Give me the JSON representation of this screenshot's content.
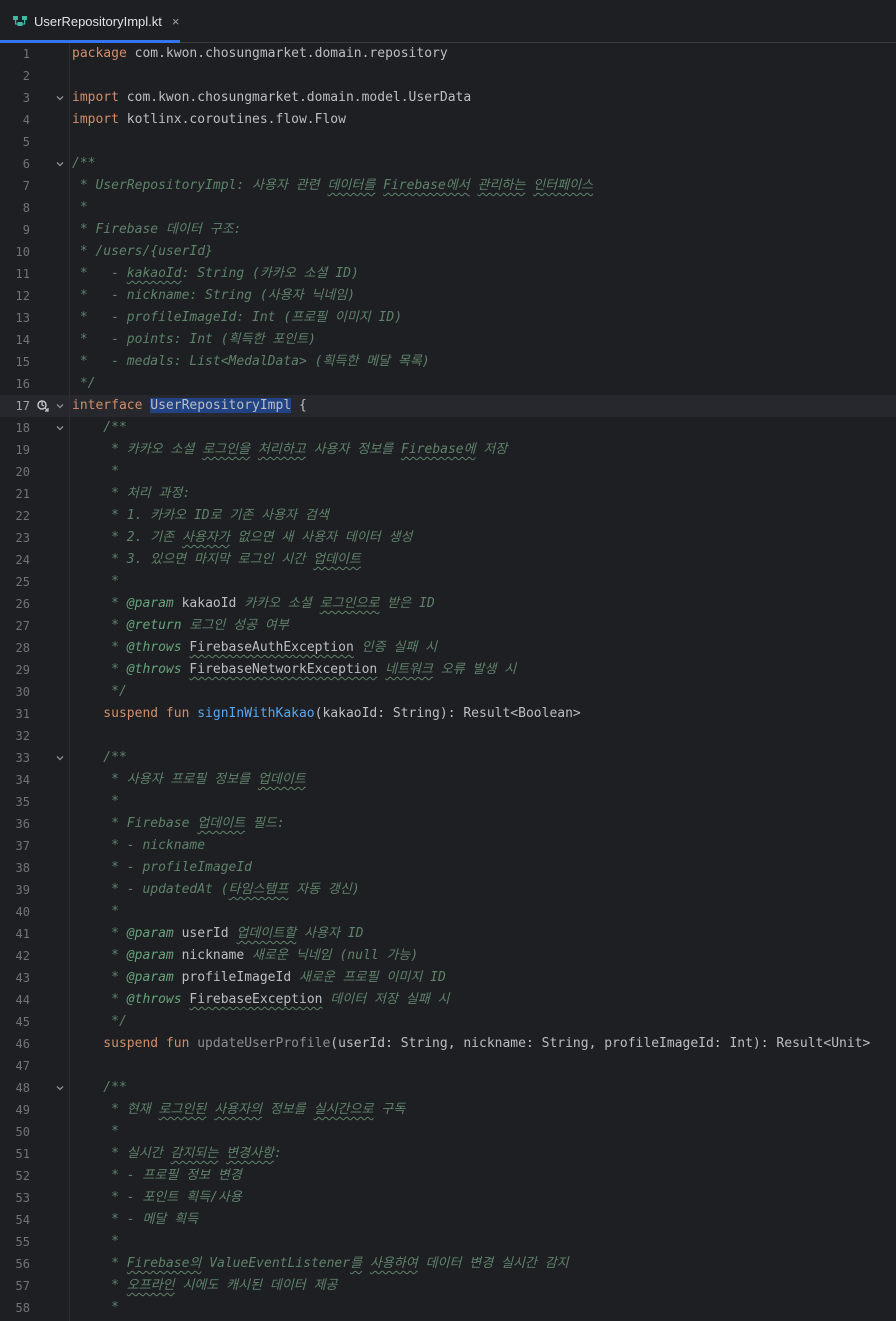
{
  "tab": {
    "label": "UserRepositoryImpl.kt",
    "close": "×"
  },
  "current_line": 17,
  "lines": [
    {
      "n": 1,
      "tokens": [
        {
          "t": "package ",
          "c": "kw"
        },
        {
          "t": "com.kwon.chosungmarket.domain.repository",
          "c": "ty"
        }
      ]
    },
    {
      "n": 2,
      "tokens": []
    },
    {
      "n": 3,
      "fold": true,
      "tokens": [
        {
          "t": "import ",
          "c": "kw"
        },
        {
          "t": "com.kwon.chosungmarket.domain.model.UserData",
          "c": "ty"
        }
      ]
    },
    {
      "n": 4,
      "tokens": [
        {
          "t": "import ",
          "c": "kw"
        },
        {
          "t": "kotlinx.coroutines.flow.Flow",
          "c": "ty"
        }
      ]
    },
    {
      "n": 5,
      "tokens": []
    },
    {
      "n": 6,
      "fold": true,
      "tokens": [
        {
          "t": "/**",
          "c": "cm"
        }
      ]
    },
    {
      "n": 7,
      "tokens": [
        {
          "t": " * UserRepositoryImpl: 사용자 관련 ",
          "c": "cm"
        },
        {
          "t": "데이터를",
          "c": "cm wavy"
        },
        {
          "t": " ",
          "c": "cm"
        },
        {
          "t": "Firebase에서",
          "c": "cm wavy"
        },
        {
          "t": " ",
          "c": "cm"
        },
        {
          "t": "관리하는",
          "c": "cm wavy"
        },
        {
          "t": " ",
          "c": "cm"
        },
        {
          "t": "인터페이스",
          "c": "cm wavy"
        }
      ]
    },
    {
      "n": 8,
      "tokens": [
        {
          "t": " *",
          "c": "cm"
        }
      ]
    },
    {
      "n": 9,
      "tokens": [
        {
          "t": " * Firebase 데이터 구조:",
          "c": "cm"
        }
      ]
    },
    {
      "n": 10,
      "tokens": [
        {
          "t": " * /users/{userId}",
          "c": "cm"
        }
      ]
    },
    {
      "n": 11,
      "tokens": [
        {
          "t": " *   - ",
          "c": "cm"
        },
        {
          "t": "kakaoId",
          "c": "cm wavy"
        },
        {
          "t": ": String (카카오 소셜 ID)",
          "c": "cm"
        }
      ]
    },
    {
      "n": 12,
      "tokens": [
        {
          "t": " *   - nickname: String (사용자 닉네임)",
          "c": "cm"
        }
      ]
    },
    {
      "n": 13,
      "tokens": [
        {
          "t": " *   - profileImageId: Int (프로필 이미지 ID)",
          "c": "cm"
        }
      ]
    },
    {
      "n": 14,
      "tokens": [
        {
          "t": " *   - points: Int (획득한 포인트)",
          "c": "cm"
        }
      ]
    },
    {
      "n": 15,
      "tokens": [
        {
          "t": " *   - medals: List<MedalData> (획득한 메달 목록)",
          "c": "cm"
        }
      ]
    },
    {
      "n": 16,
      "tokens": [
        {
          "t": " */",
          "c": "cm"
        }
      ]
    },
    {
      "n": 17,
      "fold": true,
      "marker": true,
      "tokens": [
        {
          "t": "interface ",
          "c": "kw"
        },
        {
          "t": "UserRepositoryImpl",
          "c": "sel"
        },
        {
          "t": " {",
          "c": "ty"
        }
      ]
    },
    {
      "n": 18,
      "fold": true,
      "tokens": [
        {
          "t": "    /**",
          "c": "cm"
        }
      ]
    },
    {
      "n": 19,
      "tokens": [
        {
          "t": "     * 카카오 소셜 ",
          "c": "cm"
        },
        {
          "t": "로그인을",
          "c": "cm wavy"
        },
        {
          "t": " ",
          "c": "cm"
        },
        {
          "t": "처리하고",
          "c": "cm wavy"
        },
        {
          "t": " 사용자 정보를 ",
          "c": "cm"
        },
        {
          "t": "Firebase에",
          "c": "cm wavy"
        },
        {
          "t": " 저장",
          "c": "cm"
        }
      ]
    },
    {
      "n": 20,
      "tokens": [
        {
          "t": "     *",
          "c": "cm"
        }
      ]
    },
    {
      "n": 21,
      "tokens": [
        {
          "t": "     * 처리 과정:",
          "c": "cm"
        }
      ]
    },
    {
      "n": 22,
      "tokens": [
        {
          "t": "     * 1. 카카오 ID로 기존 사용자 검색",
          "c": "cm"
        }
      ]
    },
    {
      "n": 23,
      "tokens": [
        {
          "t": "     * 2. 기존 ",
          "c": "cm"
        },
        {
          "t": "사용자가",
          "c": "cm wavy"
        },
        {
          "t": " 없으면 새 사용자 데이터 생성",
          "c": "cm"
        }
      ]
    },
    {
      "n": 24,
      "tokens": [
        {
          "t": "     * 3. 있으면 마지막 로그인 시간 ",
          "c": "cm"
        },
        {
          "t": "업데이트",
          "c": "cm wavy"
        }
      ]
    },
    {
      "n": 25,
      "tokens": [
        {
          "t": "     *",
          "c": "cm"
        }
      ]
    },
    {
      "n": 26,
      "tokens": [
        {
          "t": "     * ",
          "c": "cm"
        },
        {
          "t": "@param",
          "c": "tag"
        },
        {
          "t": " ",
          "c": "cm"
        },
        {
          "t": "kakaoId",
          "c": "ty"
        },
        {
          "t": " 카카오 소셜 ",
          "c": "cm"
        },
        {
          "t": "로그인으로",
          "c": "cm wavy"
        },
        {
          "t": " 받은 ID",
          "c": "cm"
        }
      ]
    },
    {
      "n": 27,
      "tokens": [
        {
          "t": "     * ",
          "c": "cm"
        },
        {
          "t": "@return",
          "c": "tag"
        },
        {
          "t": " 로그인 성공 여부",
          "c": "cm"
        }
      ]
    },
    {
      "n": 28,
      "tokens": [
        {
          "t": "     * ",
          "c": "cm"
        },
        {
          "t": "@throws",
          "c": "tag"
        },
        {
          "t": " ",
          "c": "cm"
        },
        {
          "t": "FirebaseAuthException",
          "c": "ty wavy"
        },
        {
          "t": " 인증 실패 시",
          "c": "cm"
        }
      ]
    },
    {
      "n": 29,
      "tokens": [
        {
          "t": "     * ",
          "c": "cm"
        },
        {
          "t": "@throws",
          "c": "tag"
        },
        {
          "t": " ",
          "c": "cm"
        },
        {
          "t": "FirebaseNetworkException",
          "c": "ty wavy"
        },
        {
          "t": " ",
          "c": "cm"
        },
        {
          "t": "네트워크",
          "c": "cm wavy"
        },
        {
          "t": " 오류 발생 시",
          "c": "cm"
        }
      ]
    },
    {
      "n": 30,
      "tokens": [
        {
          "t": "     */",
          "c": "cm"
        }
      ]
    },
    {
      "n": 31,
      "tokens": [
        {
          "t": "    suspend fun ",
          "c": "kw"
        },
        {
          "t": "signInWithKakao",
          "c": "fn"
        },
        {
          "t": "(kakaoId: String): Result<Boolean>",
          "c": "ty"
        }
      ]
    },
    {
      "n": 32,
      "tokens": []
    },
    {
      "n": 33,
      "fold": true,
      "tokens": [
        {
          "t": "    /**",
          "c": "cm"
        }
      ]
    },
    {
      "n": 34,
      "tokens": [
        {
          "t": "     * 사용자 프로필 정보를 ",
          "c": "cm"
        },
        {
          "t": "업데이트",
          "c": "cm wavy"
        }
      ]
    },
    {
      "n": 35,
      "tokens": [
        {
          "t": "     *",
          "c": "cm"
        }
      ]
    },
    {
      "n": 36,
      "tokens": [
        {
          "t": "     * Firebase ",
          "c": "cm"
        },
        {
          "t": "업데이트",
          "c": "cm wavy"
        },
        {
          "t": " 필드:",
          "c": "cm"
        }
      ]
    },
    {
      "n": 37,
      "tokens": [
        {
          "t": "     * - nickname",
          "c": "cm"
        }
      ]
    },
    {
      "n": 38,
      "tokens": [
        {
          "t": "     * - profileImageId",
          "c": "cm"
        }
      ]
    },
    {
      "n": 39,
      "tokens": [
        {
          "t": "     * - updatedAt (",
          "c": "cm"
        },
        {
          "t": "타임스탬프",
          "c": "cm wavy"
        },
        {
          "t": " 자동 갱신)",
          "c": "cm"
        }
      ]
    },
    {
      "n": 40,
      "tokens": [
        {
          "t": "     *",
          "c": "cm"
        }
      ]
    },
    {
      "n": 41,
      "tokens": [
        {
          "t": "     * ",
          "c": "cm"
        },
        {
          "t": "@param",
          "c": "tag"
        },
        {
          "t": " ",
          "c": "cm"
        },
        {
          "t": "userId",
          "c": "ty"
        },
        {
          "t": " ",
          "c": "cm"
        },
        {
          "t": "업데이트할",
          "c": "cm wavy"
        },
        {
          "t": " 사용자 ID",
          "c": "cm"
        }
      ]
    },
    {
      "n": 42,
      "tokens": [
        {
          "t": "     * ",
          "c": "cm"
        },
        {
          "t": "@param",
          "c": "tag"
        },
        {
          "t": " ",
          "c": "cm"
        },
        {
          "t": "nickname",
          "c": "ty"
        },
        {
          "t": " 새로운 닉네임 (null 가능)",
          "c": "cm"
        }
      ]
    },
    {
      "n": 43,
      "tokens": [
        {
          "t": "     * ",
          "c": "cm"
        },
        {
          "t": "@param",
          "c": "tag"
        },
        {
          "t": " ",
          "c": "cm"
        },
        {
          "t": "profileImageId",
          "c": "ty"
        },
        {
          "t": " 새로운 프로필 이미지 ID",
          "c": "cm"
        }
      ]
    },
    {
      "n": 44,
      "tokens": [
        {
          "t": "     * ",
          "c": "cm"
        },
        {
          "t": "@throws",
          "c": "tag"
        },
        {
          "t": " ",
          "c": "cm"
        },
        {
          "t": "FirebaseException",
          "c": "ty wavy"
        },
        {
          "t": " 데이터 저장 실패 시",
          "c": "cm"
        }
      ]
    },
    {
      "n": 45,
      "tokens": [
        {
          "t": "     */",
          "c": "cm"
        }
      ]
    },
    {
      "n": 46,
      "tokens": [
        {
          "t": "    suspend fun ",
          "c": "kw"
        },
        {
          "t": "updateUserProfile",
          "c": "unused"
        },
        {
          "t": "(userId: String, nickname: String, profileImageId: Int): Result<Unit>",
          "c": "ty"
        }
      ]
    },
    {
      "n": 47,
      "tokens": []
    },
    {
      "n": 48,
      "fold": true,
      "tokens": [
        {
          "t": "    /**",
          "c": "cm"
        }
      ]
    },
    {
      "n": 49,
      "tokens": [
        {
          "t": "     * 현재 ",
          "c": "cm"
        },
        {
          "t": "로그인된",
          "c": "cm wavy"
        },
        {
          "t": " ",
          "c": "cm"
        },
        {
          "t": "사용자의",
          "c": "cm wavy"
        },
        {
          "t": " 정보를 ",
          "c": "cm"
        },
        {
          "t": "실시간으로",
          "c": "cm wavy"
        },
        {
          "t": " 구독",
          "c": "cm"
        }
      ]
    },
    {
      "n": 50,
      "tokens": [
        {
          "t": "     *",
          "c": "cm"
        }
      ]
    },
    {
      "n": 51,
      "tokens": [
        {
          "t": "     * 실시간 ",
          "c": "cm"
        },
        {
          "t": "감지되는",
          "c": "cm wavy"
        },
        {
          "t": " ",
          "c": "cm"
        },
        {
          "t": "변경사항",
          "c": "cm wavy"
        },
        {
          "t": ":",
          "c": "cm"
        }
      ]
    },
    {
      "n": 52,
      "tokens": [
        {
          "t": "     * - 프로필 정보 변경",
          "c": "cm"
        }
      ]
    },
    {
      "n": 53,
      "tokens": [
        {
          "t": "     * - 포인트 획득/사용",
          "c": "cm"
        }
      ]
    },
    {
      "n": 54,
      "tokens": [
        {
          "t": "     * - 메달 획득",
          "c": "cm"
        }
      ]
    },
    {
      "n": 55,
      "tokens": [
        {
          "t": "     *",
          "c": "cm"
        }
      ]
    },
    {
      "n": 56,
      "tokens": [
        {
          "t": "     * ",
          "c": "cm"
        },
        {
          "t": "Firebase의",
          "c": "cm wavy"
        },
        {
          "t": " ValueEventListener",
          "c": "cm"
        },
        {
          "t": "를",
          "c": "cm wavy"
        },
        {
          "t": " ",
          "c": "cm"
        },
        {
          "t": "사용하여",
          "c": "cm wavy"
        },
        {
          "t": " 데이터 변경 실시간 감지",
          "c": "cm"
        }
      ]
    },
    {
      "n": 57,
      "tokens": [
        {
          "t": "     * ",
          "c": "cm"
        },
        {
          "t": "오프라인",
          "c": "cm wavy"
        },
        {
          "t": " 시에도 캐시된 데이터 제공",
          "c": "cm"
        }
      ]
    },
    {
      "n": 58,
      "tokens": [
        {
          "t": "     *",
          "c": "cm"
        }
      ]
    }
  ]
}
